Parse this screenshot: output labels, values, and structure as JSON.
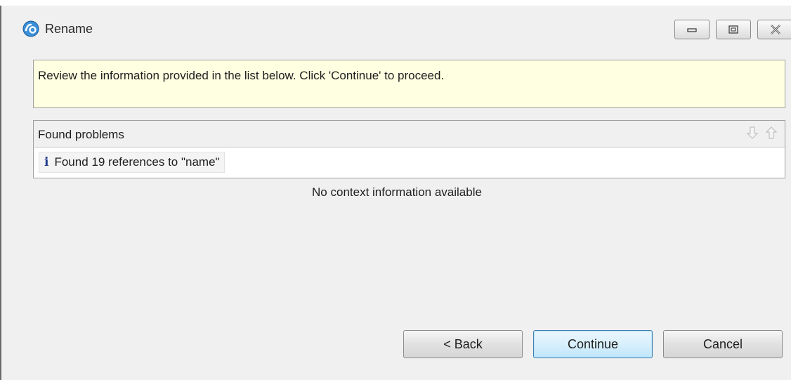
{
  "window": {
    "title": "Rename",
    "controls": {
      "minimize": "minimize-icon",
      "maximize": "maximize-icon",
      "close": "close-icon"
    }
  },
  "banner": {
    "message": "Review the information provided in the list below. Click 'Continue' to proceed."
  },
  "problems": {
    "header": "Found problems",
    "items": [
      {
        "icon": "info-icon",
        "text": "Found 19 references to \"name\""
      }
    ]
  },
  "context": {
    "message": "No context information available"
  },
  "buttons": {
    "back": "< Back",
    "continue": "Continue",
    "cancel": "Cancel"
  },
  "colors": {
    "banner_bg": "#ffffe1",
    "default_button_border": "#3c7fb1",
    "info_icon": "#1f3a8c"
  }
}
